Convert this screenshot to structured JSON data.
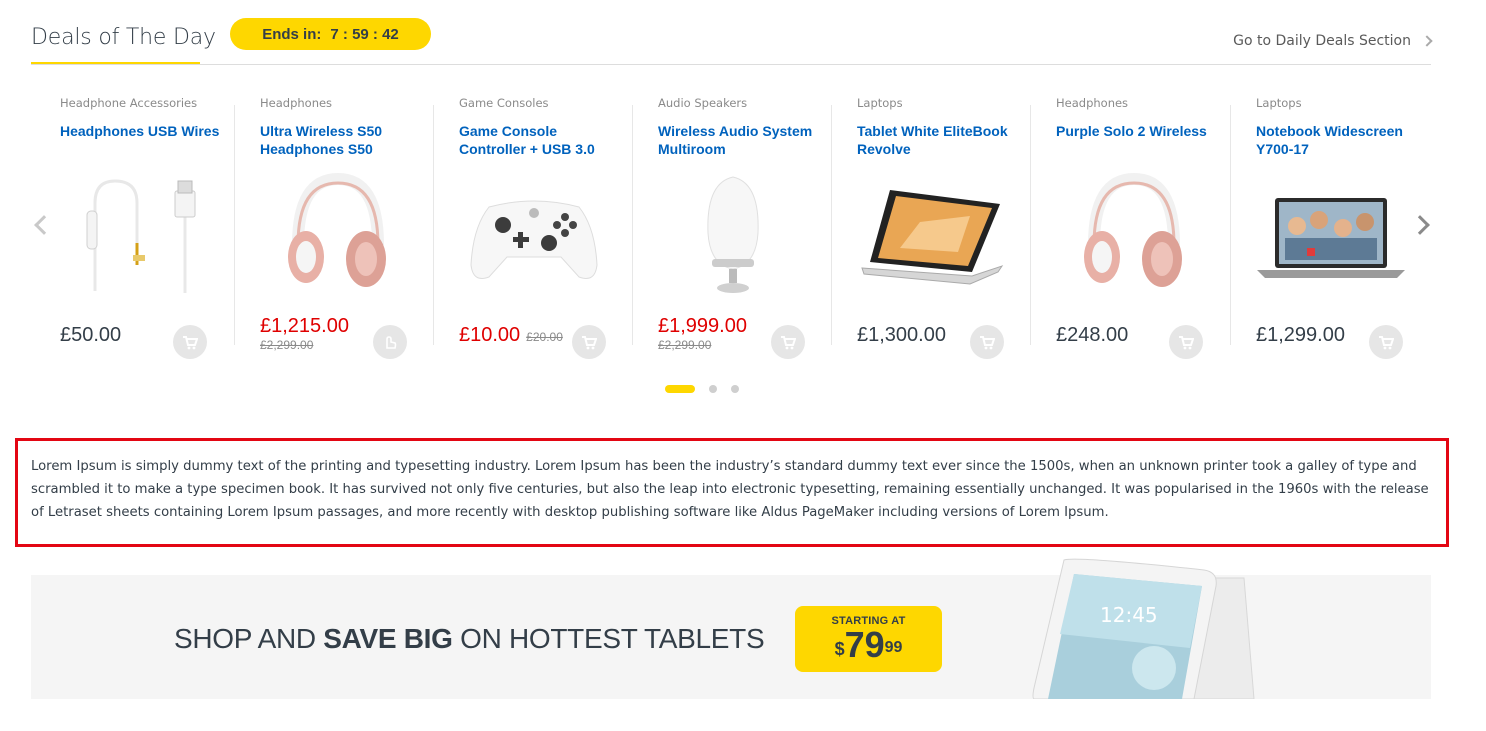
{
  "header": {
    "title": "Deals of The Day",
    "countdown_label": "Ends in:",
    "countdown_time": "7 : 59 : 42",
    "go_link": "Go to Daily Deals Section"
  },
  "products": [
    {
      "category": "Headphone Accessories",
      "name": "Headphones USB Wires",
      "price": "£50.00",
      "old_price": "",
      "sale": false,
      "icon": "usb-cable"
    },
    {
      "category": "Headphones",
      "name": "Ultra Wireless S50 Headphones S50",
      "price": "£1,215.00",
      "old_price": "£2,299.00",
      "sale": true,
      "icon": "headphones"
    },
    {
      "category": "Game Consoles",
      "name": "Game Console Controller + USB 3.0",
      "price": "£10.00",
      "old_price": "£20.00",
      "sale": true,
      "icon": "game-controller"
    },
    {
      "category": "Audio Speakers",
      "name": "Wireless Audio System Multiroom",
      "price": "£1,999.00",
      "old_price": "£2,299.00",
      "sale": true,
      "icon": "speaker"
    },
    {
      "category": "Laptops",
      "name": "Tablet White EliteBook Revolve",
      "price": "£1,300.00",
      "old_price": "",
      "sale": false,
      "icon": "convertible-laptop"
    },
    {
      "category": "Headphones",
      "name": "Purple Solo 2 Wireless",
      "price": "£248.00",
      "old_price": "",
      "sale": false,
      "icon": "headphones"
    },
    {
      "category": "Laptops",
      "name": "Notebook Widescreen Y700-17",
      "price": "£1,299.00",
      "old_price": "",
      "sale": false,
      "icon": "laptop"
    }
  ],
  "lorem": "Lorem Ipsum is simply dummy text of the printing and typesetting industry. Lorem Ipsum has been the industry’s standard dummy text ever since the 1500s, when an unknown printer took a galley of type and scrambled it to make a type specimen book. It has survived not only five centuries, but also the leap into electronic typesetting, remaining essentially unchanged. It was popularised in the 1960s with the release of Letraset sheets containing Lorem Ipsum passages, and more recently with desktop publishing software like Aldus PageMaker including versions of Lorem Ipsum.",
  "banner": {
    "text_before": "SHOP AND ",
    "text_bold": "SAVE BIG",
    "text_after": " ON HOTTEST TABLETS",
    "badge_top": "STARTING AT",
    "badge_currency": "$",
    "badge_main": "79",
    "badge_cents": "99",
    "tablet_time": "12:45"
  },
  "colors": {
    "accent": "#fed700",
    "link": "#0062bd",
    "sale": "#df0000",
    "highlight_border": "#e30613"
  }
}
